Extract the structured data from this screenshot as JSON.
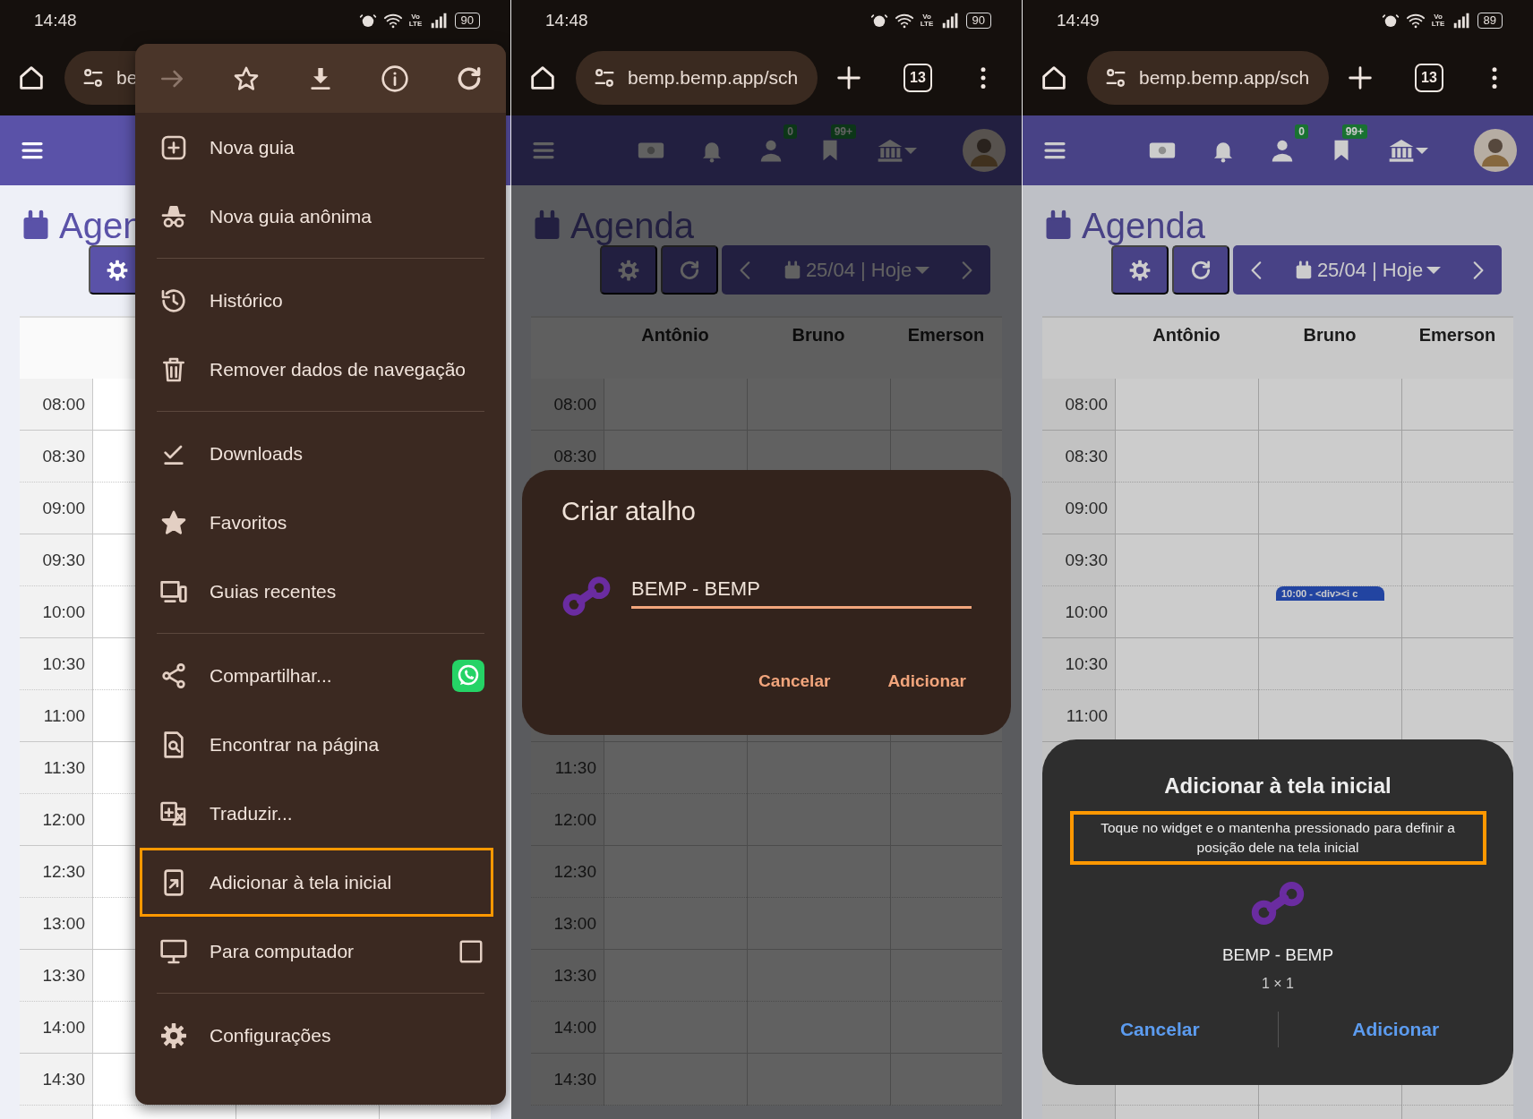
{
  "panels": [
    {
      "kind": "menu",
      "status_bar": {
        "time": "14:48",
        "network": "Vo LTE",
        "battery": "90"
      },
      "browser_bar": {
        "url": "be"
      },
      "app": {
        "title": "Agen",
        "times": [
          {
            "time": "08:00"
          },
          {
            "time": "08:30"
          },
          {
            "time": "09:00"
          },
          {
            "time": "09:30"
          },
          {
            "time": "10:00"
          },
          {
            "time": "10:30"
          },
          {
            "time": "11:00"
          },
          {
            "time": "11:30"
          },
          {
            "time": "12:00"
          },
          {
            "time": "12:30"
          },
          {
            "time": "13:00"
          },
          {
            "time": "13:30"
          },
          {
            "time": "14:00"
          },
          {
            "time": "14:30"
          }
        ]
      },
      "menu": {
        "actions": [
          {
            "kind": "forward",
            "disabled": true
          },
          {
            "kind": "star",
            "disabled": false
          },
          {
            "kind": "download",
            "disabled": false
          },
          {
            "kind": "info",
            "disabled": false
          },
          {
            "kind": "reload",
            "disabled": false
          }
        ],
        "items": [
          {
            "kind": "new-tab",
            "label": "Nova guia",
            "highlighted": false
          },
          {
            "kind": "incognito",
            "label": "Nova guia anônima",
            "highlighted": false
          },
          {
            "kind": "divider"
          },
          {
            "kind": "history",
            "label": "Histórico",
            "highlighted": false
          },
          {
            "kind": "trash",
            "label": "Remover dados de navegação",
            "highlighted": false
          },
          {
            "kind": "divider"
          },
          {
            "kind": "downloads",
            "label": "Downloads",
            "highlighted": false
          },
          {
            "kind": "favorites",
            "label": "Favoritos",
            "highlighted": false
          },
          {
            "kind": "devices",
            "label": "Guias recentes",
            "highlighted": false
          },
          {
            "kind": "divider"
          },
          {
            "kind": "share",
            "label": "Compartilhar...",
            "highlighted": false
          },
          {
            "kind": "find",
            "label": "Encontrar na página",
            "highlighted": false
          },
          {
            "kind": "translate",
            "label": "Traduzir...",
            "highlighted": false
          },
          {
            "kind": "add-home",
            "label": "Adicionar à tela inicial",
            "highlighted": true
          },
          {
            "kind": "desktop",
            "label": "Para computador",
            "highlighted": false,
            "checked": false
          },
          {
            "kind": "divider"
          },
          {
            "kind": "settings",
            "label": "Configurações",
            "highlighted": false
          }
        ]
      }
    },
    {
      "kind": "shortcut",
      "status_bar": {
        "time": "14:48",
        "network": "Vo LTE",
        "battery": "90"
      },
      "browser_bar": {
        "url": "bemp.bemp.app/sch",
        "tab_count": "13"
      },
      "app": {
        "title": "Agenda",
        "user_badge": "0",
        "bookmark_badge": "99+",
        "date_label": "25/04 | Hoje",
        "columns": [
          "Antônio",
          "Bruno",
          "Emerson"
        ],
        "times": [
          {
            "time": "08:00"
          },
          {
            "time": "08:30"
          },
          {
            "time": "11:30"
          },
          {
            "time": "12:00"
          },
          {
            "time": "12:30"
          },
          {
            "time": "13:00"
          },
          {
            "time": "13:30"
          },
          {
            "time": "14:00"
          },
          {
            "time": "14:30"
          }
        ]
      },
      "dialog": {
        "title": "Criar atalho",
        "value": "BEMP - BEMP",
        "buttons": [
          "Cancelar",
          "Adicionar"
        ]
      }
    },
    {
      "kind": "widget",
      "status_bar": {
        "time": "14:49",
        "network": "Vo LTE",
        "battery": "89"
      },
      "browser_bar": {
        "url": "bemp.bemp.app/sch",
        "tab_count": "13"
      },
      "app": {
        "title": "Agenda",
        "user_badge": "0",
        "bookmark_badge": "99+",
        "date_label": "25/04 | Hoje",
        "columns": [
          "Antônio",
          "Bruno",
          "Emerson"
        ],
        "times": [
          {
            "time": "08:00"
          },
          {
            "time": "08:30"
          },
          {
            "time": "09:00"
          },
          {
            "time": "09:30"
          },
          {
            "time": "10:00",
            "event": "10:00 - <div><i c"
          },
          {
            "time": "10:30"
          },
          {
            "time": "11:00"
          }
        ]
      },
      "dialog": {
        "title": "Adicionar à tela inicial",
        "description": "Toque no widget e o mantenha pressionado para definir a posição dele na tela inicial",
        "highlighted": true,
        "app_name": "BEMP - BEMP",
        "size": "1 × 1",
        "buttons": [
          "Cancelar",
          "Adicionar"
        ]
      }
    }
  ]
}
